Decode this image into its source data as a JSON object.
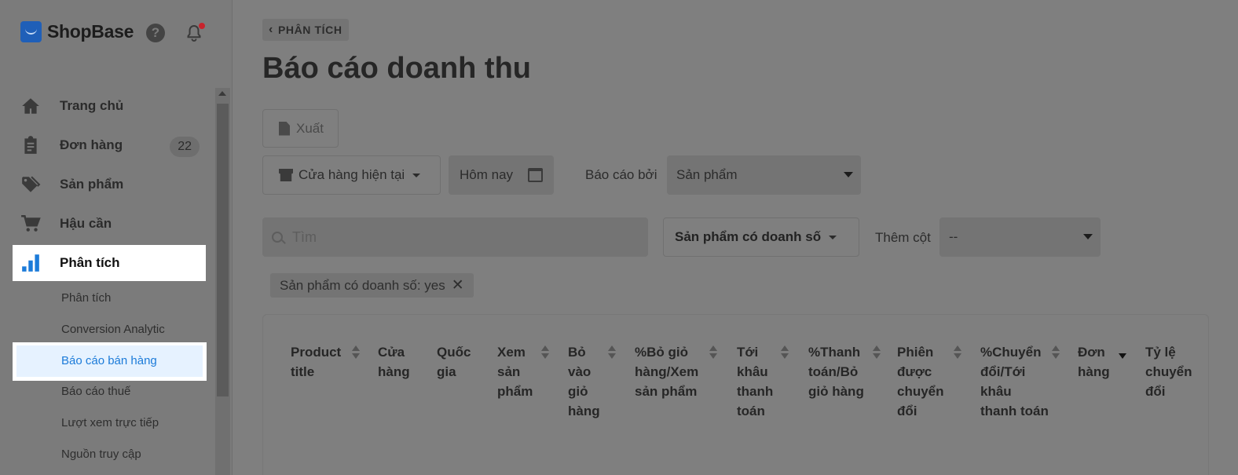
{
  "brand": {
    "name": "ShopBase"
  },
  "sidebar": {
    "items": [
      {
        "label": "Trang chủ",
        "icon": "home-icon"
      },
      {
        "label": "Đơn hàng",
        "icon": "clipboard-icon",
        "badge": "22"
      },
      {
        "label": "Sản phẩm",
        "icon": "tag-icon"
      },
      {
        "label": "Hậu cần",
        "icon": "cart-icon"
      },
      {
        "label": "Phân tích",
        "icon": "bar-chart-icon",
        "active": true
      }
    ],
    "subitems": [
      "Phân tích",
      "Conversion Analytic",
      "Báo cáo bán hàng",
      "Báo cáo thuế",
      "Lượt xem trực tiếp",
      "Nguồn truy cập"
    ],
    "active_sub": "Báo cáo bán hàng"
  },
  "breadcrumb": {
    "label": "PHÂN TÍCH"
  },
  "page": {
    "title": "Báo cáo doanh thu"
  },
  "toolbar": {
    "export_label": "Xuất",
    "store_label": "Cửa hàng hiện tại",
    "date_value": "Hôm nay",
    "report_by_label": "Báo cáo bởi",
    "report_by_value": "Sản phẩm",
    "search_placeholder": "Tìm",
    "filter_label": "Sản phẩm có doanh số",
    "add_column_label": "Thêm cột",
    "add_column_value": "--"
  },
  "filter_chip": {
    "label": "Sản phẩm có doanh số: yes"
  },
  "table": {
    "headers": [
      "Product title",
      "Cửa hàng",
      "Quốc gia",
      "Xem sản phẩm",
      "Bỏ vào giỏ hàng",
      "%Bỏ giỏ hàng/Xem sản phẩm",
      "Tới khâu thanh toán",
      "%Thanh toán/Bỏ giỏ hàng",
      "Phiên được chuyển đổi",
      "%Chuyển đổi/Tới khâu thanh toán",
      "Đơn hàng",
      "Tỷ lệ chuyển đổi"
    ]
  },
  "colors": {
    "accent": "#1c7bd9",
    "notification": "#c8232c",
    "overlay": "#7f7f7f"
  }
}
